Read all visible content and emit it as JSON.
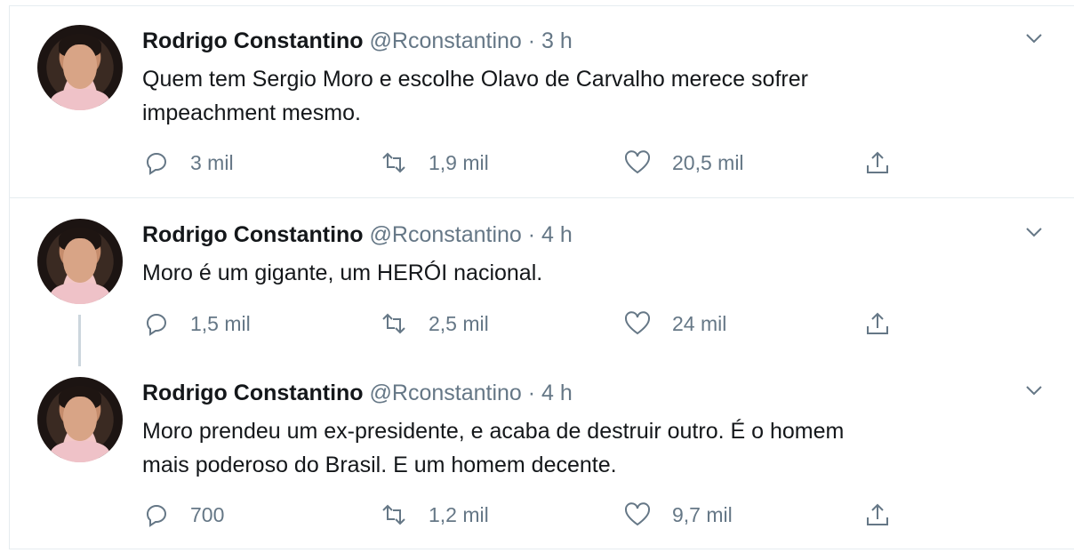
{
  "tweets": [
    {
      "name": "Rodrigo Constantino",
      "meta": "@Rconstantino · 3 h",
      "text_lines": [
        "Quem tem Sergio Moro e escolhe Olavo de Carvalho merece sofrer",
        "impeachment mesmo."
      ],
      "replies": "3 mil",
      "retweets": "1,9 mil",
      "likes": "20,5 mil"
    },
    {
      "name": "Rodrigo Constantino",
      "meta": "@Rconstantino · 4 h",
      "text_lines": [
        "Moro é um gigante, um HERÓI nacional."
      ],
      "replies": "1,5 mil",
      "retweets": "2,5 mil",
      "likes": "24 mil"
    },
    {
      "name": "Rodrigo Constantino",
      "meta": "@Rconstantino · 4 h",
      "text_lines": [
        "Moro prendeu um ex-presidente, e acaba de destruir outro. É o homem",
        "mais poderoso do Brasil. E um homem decente."
      ],
      "replies": "700",
      "retweets": "1,2 mil",
      "likes": "9,7 mil"
    }
  ],
  "icons": {
    "reply": "reply-icon",
    "retweet": "retweet-icon",
    "like": "heart-icon",
    "share": "share-icon",
    "menu": "chevron-down-icon"
  },
  "colors": {
    "text": "#14171a",
    "muted": "#657786",
    "border": "#e6ecf0",
    "thread_line": "#ccd6dd"
  }
}
